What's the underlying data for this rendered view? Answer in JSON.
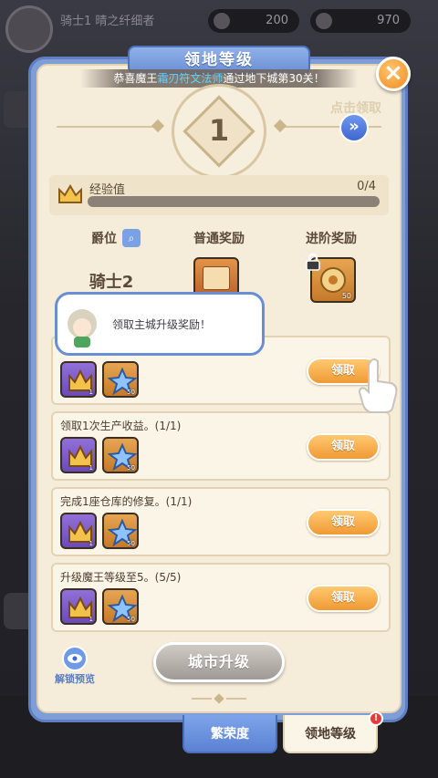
{
  "background": {
    "player_name": "骑士1 晴之纤细者",
    "resource_1": "200",
    "resource_2": "970"
  },
  "panel": {
    "title": "领地等级",
    "announcement_prefix": "恭喜魔王",
    "announcement_name": "霜刃符文法师",
    "announcement_suffix": "通过地下城第30关！",
    "side_hint": "点击领取",
    "level": "1",
    "exp": {
      "label": "经验值",
      "value": "0/4",
      "progress_fraction": 0
    },
    "columns": {
      "rank": "爵位",
      "normal_reward": "普通奖励",
      "advanced_reward": "进阶奖励"
    },
    "rank_name": "骑士2",
    "advanced_reward_count": "50"
  },
  "tutorial": {
    "text": "领取主城升级奖励！"
  },
  "tasks": [
    {
      "title": "",
      "item1_count": "1",
      "item2_count": "50",
      "button": "领取"
    },
    {
      "title": "领取1次生产收益。(1/1)",
      "item1_count": "1",
      "item2_count": "50",
      "button": "领取"
    },
    {
      "title": "完成1座仓库的修复。(1/1)",
      "item1_count": "1",
      "item2_count": "50",
      "button": "领取"
    },
    {
      "title": "升级魔王等级至5。(5/5)",
      "item1_count": "1",
      "item2_count": "50",
      "button": "领取"
    }
  ],
  "footer": {
    "preview_label": "解锁预览",
    "upgrade_button": "城市升级"
  },
  "tabs": [
    {
      "label": "繁荣度"
    },
    {
      "label": "领地等级"
    }
  ],
  "tab_alert": "!",
  "colors": {
    "accent_blue": "#6b8fd4",
    "claim_orange": "#f09a33",
    "panel_bg": "#f5ecd9",
    "alert_red": "#e83a3a"
  },
  "icons": [
    "close-icon",
    "double-chevron-right-icon",
    "crown-icon",
    "star-icon",
    "search-icon",
    "lock-icon",
    "eye-icon",
    "pointing-hand-icon"
  ]
}
